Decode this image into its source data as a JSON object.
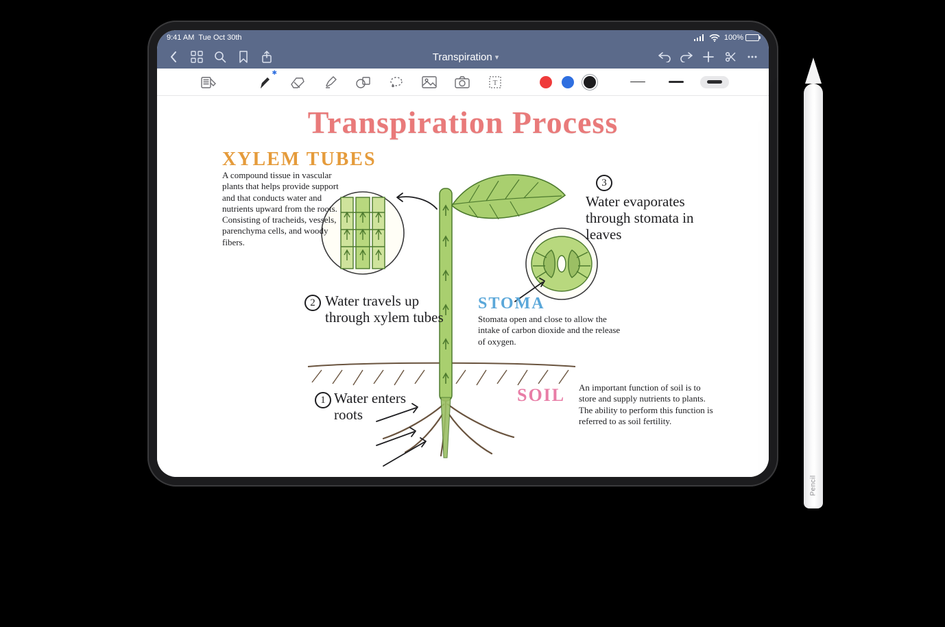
{
  "statusbar": {
    "time": "9:41 AM",
    "date": "Tue Oct 30th",
    "battery_pct": "100%"
  },
  "navbar": {
    "title": "Transpiration"
  },
  "colors": {
    "accent_nav": "#5b6a8a",
    "red": "#ef3b3b",
    "blue": "#2f6fe0",
    "black": "#1c1c1e"
  },
  "pencil": {
    "label": " Pencil"
  },
  "note": {
    "title": "Transpiration Process",
    "xylem_label": "XYLEM TUBES",
    "xylem_body": "A compound tissue in vascular plants that helps provide support and that conducts water and nutrients upward from the roots. Consisting of tracheids, vessels, parenchyma cells, and woody fibers.",
    "step1": "Water enters roots",
    "step2": "Water travels up through xylem tubes",
    "step3": "Water evaporates through stomata in leaves",
    "stoma_label": "STOMA",
    "stoma_body": "Stomata open and close to allow the intake of carbon dioxide and the release of oxygen.",
    "soil_label": "SOIL",
    "soil_body": "An important function of soil is to store and supply nutrients to plants. The ability to perform this function is referred to as soil fertility."
  }
}
